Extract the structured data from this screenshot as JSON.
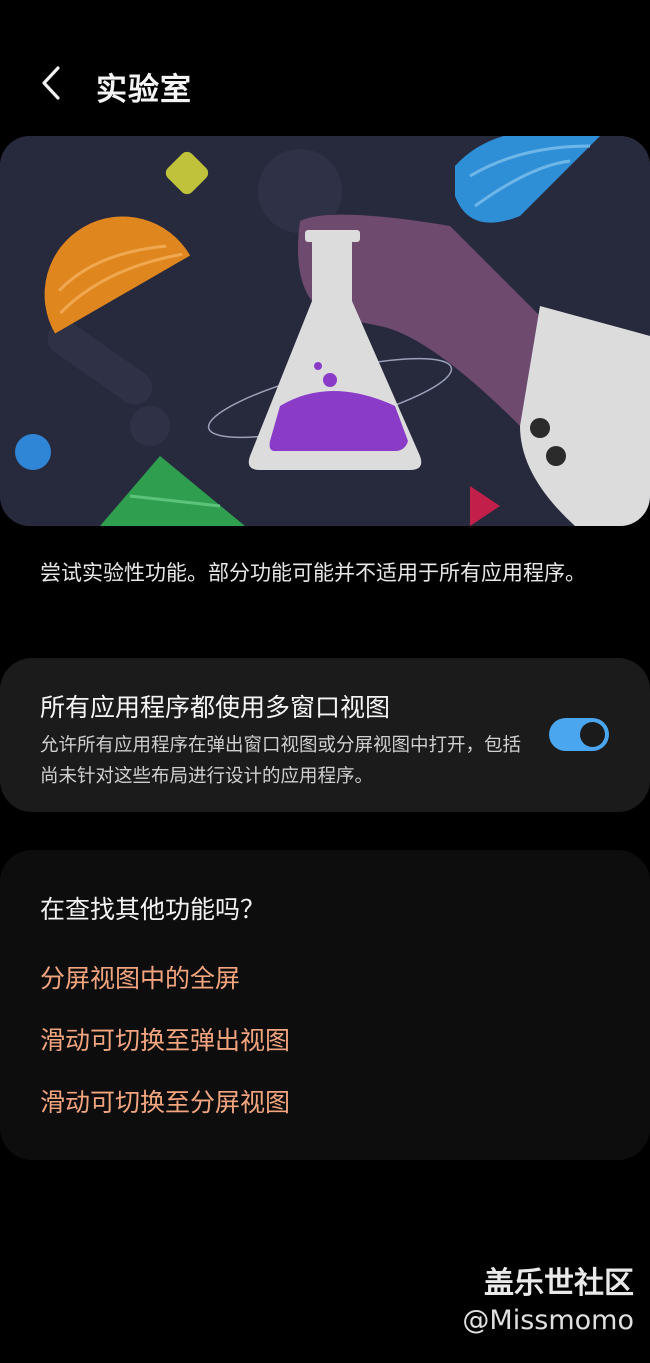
{
  "header": {
    "title": "实验室",
    "back_icon": "chevron-left-icon"
  },
  "intro": "尝试实验性功能。部分功能可能并不适用于所有应用程序。",
  "option": {
    "title": "所有应用程序都使用多窗口视图",
    "description": "允许所有应用程序在弹出窗口视图或分屏视图中打开，包括尚未针对这些布局进行设计的应用程序。",
    "enabled": true
  },
  "more": {
    "title": "在查找其他功能吗？",
    "links": [
      "分屏视图中的全屏",
      "滑动可切换至弹出视图",
      "滑动可切换至分屏视图"
    ]
  },
  "watermark": {
    "site": "盖乐世社区",
    "user": "@Missmomo"
  },
  "colors": {
    "accent": "#4ba6f0",
    "link": "#f2a57e",
    "card": "#1b1b1b"
  }
}
